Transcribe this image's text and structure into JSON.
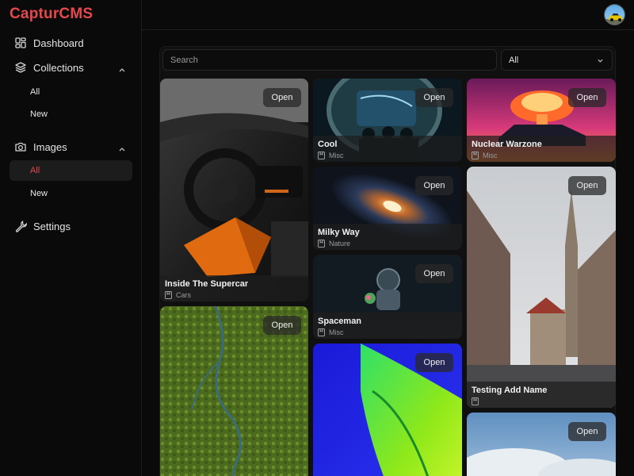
{
  "app": {
    "brand": "CapturCMS",
    "brand_color": "#e5484d"
  },
  "sidebar": {
    "dashboard": "Dashboard",
    "collections": {
      "label": "Collections",
      "sub": [
        "All",
        "New"
      ]
    },
    "images": {
      "label": "Images",
      "sub": [
        "All",
        "New"
      ],
      "active": "All"
    },
    "settings": "Settings"
  },
  "filters": {
    "search_placeholder": "Search",
    "select_value": "All"
  },
  "cards": [
    {
      "title": "Inside The Supercar",
      "category": "Cars",
      "action": "Open"
    },
    {
      "title": "",
      "category": "",
      "action": "Open"
    },
    {
      "title": "Cool",
      "category": "Misc",
      "action": "Open"
    },
    {
      "title": "Milky Way",
      "category": "Nature",
      "action": "Open"
    },
    {
      "title": "Spaceman",
      "category": "Misc",
      "action": "Open"
    },
    {
      "title": "",
      "category": "",
      "action": "Open"
    },
    {
      "title": "Nuclear Warzone",
      "category": "Misc",
      "action": "Open"
    },
    {
      "title": "Testing Add Name",
      "category": "",
      "action": "Open"
    },
    {
      "title": "",
      "category": "",
      "action": "Open"
    }
  ]
}
